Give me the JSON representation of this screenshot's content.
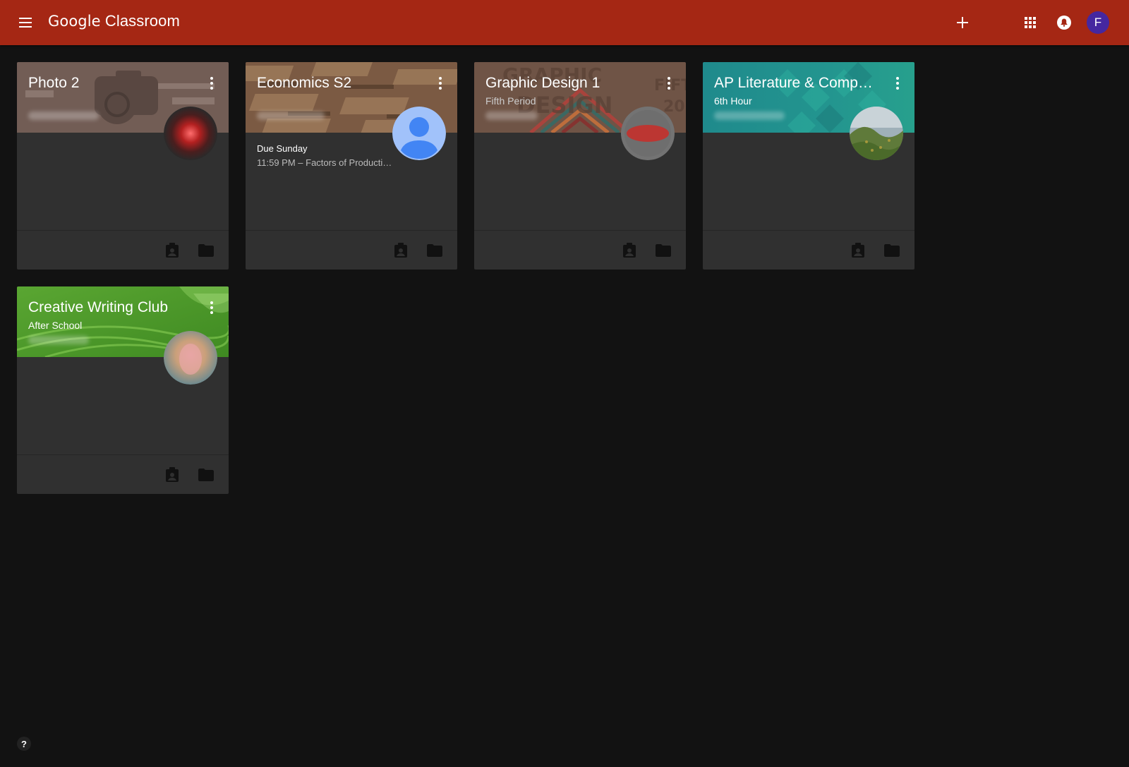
{
  "header": {
    "app_name_google": "Google",
    "app_name_product": "Classroom",
    "avatar_letter": "F",
    "icons": [
      "menu-icon",
      "plus-icon",
      "apps-grid-icon",
      "notifications-bell-icon"
    ]
  },
  "colors": {
    "topbar": "#a52714",
    "background": "#121212",
    "card": "#303030",
    "avatar": "#4527a0"
  },
  "classes": [
    {
      "title": "Photo 2",
      "section": "",
      "due_label": "",
      "due_item": "",
      "theme": "camera"
    },
    {
      "title": "Economics S2",
      "section": "",
      "due_label": "Due Sunday",
      "due_item": "11:59 PM – Factors of Producti…",
      "theme": "classroom"
    },
    {
      "title": "Graphic Design 1",
      "section": "Fifth Period",
      "due_label": "",
      "due_item": "",
      "theme": "graphic-design"
    },
    {
      "title": "AP Literature & Comp…",
      "section": "6th Hour",
      "due_label": "",
      "due_item": "",
      "theme": "teal"
    },
    {
      "title": "Creative Writing Club",
      "section": "After School",
      "due_label": "",
      "due_item": "",
      "theme": "green-book"
    }
  ],
  "help": {
    "label": "?"
  }
}
